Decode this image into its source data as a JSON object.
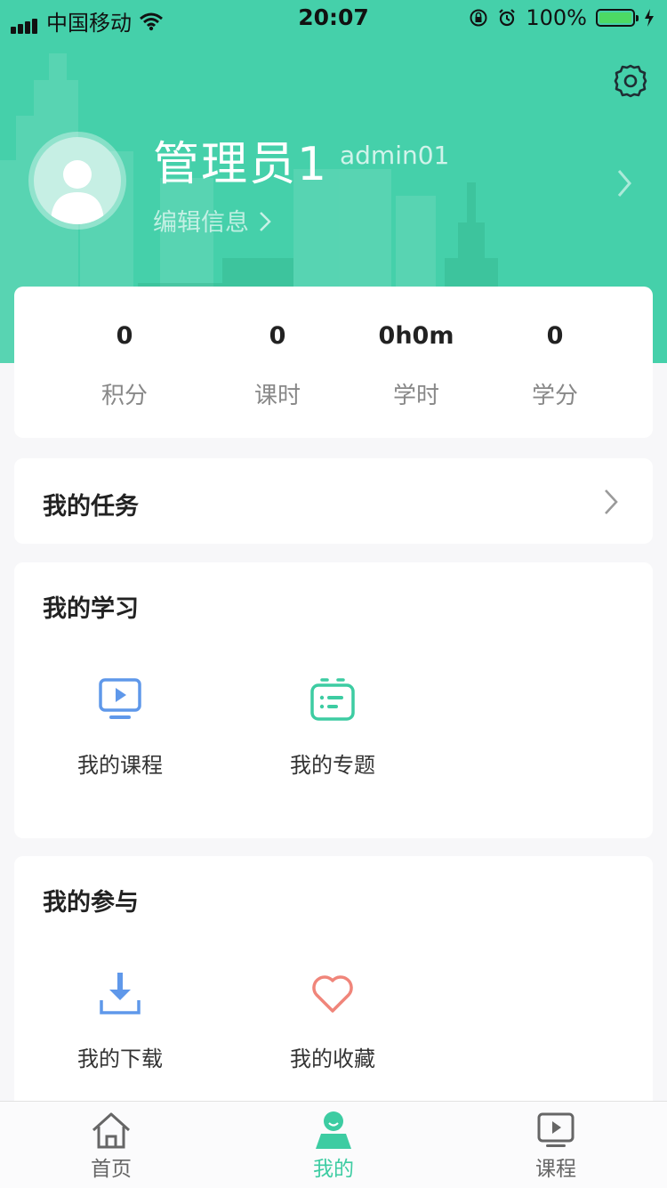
{
  "status_bar": {
    "carrier": "中国移动",
    "time": "20:07",
    "battery": "100%"
  },
  "header": {
    "name": "管理员1",
    "account": "admin01",
    "edit_label": "编辑信息",
    "accent_color": "#45d0aa"
  },
  "stats": [
    {
      "value": "0",
      "label": "积分"
    },
    {
      "value": "0",
      "label": "课时"
    },
    {
      "value": "0h0m",
      "label": "学时"
    },
    {
      "value": "0",
      "label": "学分"
    }
  ],
  "task": {
    "label": "我的任务"
  },
  "study": {
    "title": "我的学习",
    "items": [
      {
        "label": "我的课程",
        "icon": "course-icon"
      },
      {
        "label": "我的专题",
        "icon": "topic-icon"
      }
    ]
  },
  "join": {
    "title": "我的参与",
    "items": [
      {
        "label": "我的下载",
        "icon": "download-icon"
      },
      {
        "label": "我的收藏",
        "icon": "heart-icon"
      }
    ]
  },
  "tabbar": {
    "items": [
      {
        "label": "首页",
        "icon": "home-icon",
        "active": false
      },
      {
        "label": "我的",
        "icon": "profile-icon",
        "active": true
      },
      {
        "label": "课程",
        "icon": "course-tab-icon",
        "active": false
      }
    ],
    "active_color": "#3dcca2",
    "inactive_color": "#666666"
  }
}
